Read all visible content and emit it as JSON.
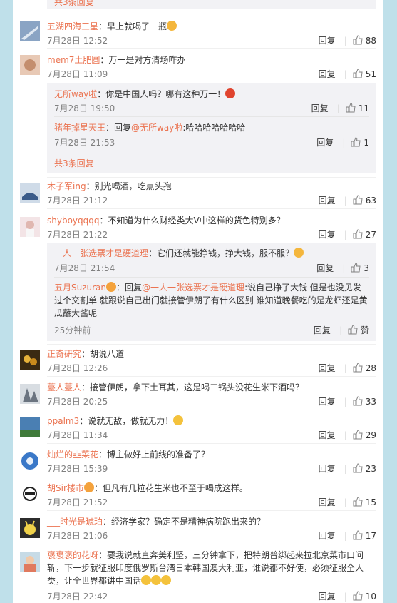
{
  "top_more": "共3条回复",
  "comments": [
    {
      "name": "五湖四海三星",
      "text": "：早上就喝了一瓶",
      "time": "7月28日 12:52",
      "reply": "回复",
      "likes": "88"
    },
    {
      "name": "mem7土肥圆",
      "text": "：万一是对方清场咋办",
      "time": "7月28日 11:09",
      "reply": "回复",
      "likes": "51",
      "subs": [
        {
          "name": "无所way啦",
          "text": "：你是中国人吗？哪有这种万一！",
          "time": "7月28日 19:50",
          "reply": "回复",
          "likes": "11"
        },
        {
          "name": "猪年掉星天王",
          "text": "：回复",
          "mention": "@无所way啦",
          "text2": ":哈哈哈哈哈哈哈",
          "time": "7月28日 21:53",
          "reply": "回复",
          "likes": "1"
        }
      ],
      "more": "共3条回复"
    },
    {
      "name": "木子军ing",
      "text": "：别光喝酒，吃点头孢",
      "time": "7月28日 21:12",
      "reply": "回复",
      "likes": "63"
    },
    {
      "name": "shyboyqqqq",
      "text": "：不知道为什么财经类大V中这样的货色特别多？",
      "time": "7月28日 21:22",
      "reply": "回复",
      "likes": "27",
      "subs": [
        {
          "name": "一人一张选票才是硬道理",
          "text": "：它们还就能挣钱，挣大钱，服不服？",
          "time": "7月28日 21:54",
          "reply": "回复",
          "likes": "3"
        },
        {
          "name": "五月Suzuran",
          "text": "：回复",
          "mention": "@一人一张选票才是硬道理",
          "text2": ":说自己挣了大钱 但是也没见发过个交割单 就跟说自己出门就接管伊朗了有什么区别 谁知道晚餐吃的是龙虾还是黄瓜蘸大酱呢",
          "time": "25分钟前",
          "reply": "回复",
          "likes": "赞"
        }
      ]
    },
    {
      "name": "正奇研究",
      "text": "：胡说八道",
      "time": "7月28日 12:26",
      "reply": "回复",
      "likes": "28"
    },
    {
      "name": "薹人薹人",
      "text": "：接管伊朗，拿下土耳其，这是喝二锅头没花生米下酒吗？",
      "time": "7月28日 20:25",
      "reply": "回复",
      "likes": "33"
    },
    {
      "name": "ppalm3",
      "text": "：说就无敌，做就无力！",
      "time": "7月28日 11:34",
      "reply": "回复",
      "likes": "29"
    },
    {
      "name": "灿烂的韭菜花",
      "text": "：博主做好上前线的准备了？",
      "time": "7月28日 15:39",
      "reply": "回复",
      "likes": "23"
    },
    {
      "name": "胡Sir楼市",
      "text": "：但凡有几粒花生米也不至于喝成这样。",
      "time": "7月28日 21:52",
      "reply": "回复",
      "likes": "15"
    },
    {
      "name": "___时光是琥珀",
      "text": "：经济学家？确定不是精神病院跑出来的？",
      "time": "7月28日 21:06",
      "reply": "回复",
      "likes": "17"
    },
    {
      "name": "褒褒褒的花呀",
      "text": "：要我说就直奔美利坚，三分钟拿下，把特朗普绑起来拉北京菜市口问斩，下一步就征服印度俄罗斯台湾日本韩国澳大利亚，谁说都不好使，必须征服全人类，让全世界都讲中国话",
      "time": "7月28日 22:42",
      "reply": "回复",
      "likes": "10"
    }
  ],
  "colors": {
    "name": "#eb7350",
    "meta": "#808080",
    "bg": "#bfe0ea"
  }
}
